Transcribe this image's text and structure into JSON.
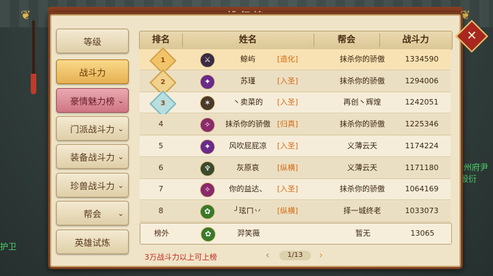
{
  "window": {
    "title": "排行榜"
  },
  "background": {
    "npc_left": "护卫",
    "npc_right_name": "苏州府尹",
    "npc_right_sub": "殷衍"
  },
  "sidebar": {
    "tabs": [
      {
        "label": "等级",
        "state": "normal",
        "chevron": ""
      },
      {
        "label": "战斗力",
        "state": "active",
        "chevron": ""
      },
      {
        "label": "豪情魅力榜",
        "state": "pink",
        "chevron": "⌄"
      },
      {
        "label": "门派战斗力",
        "state": "normal",
        "chevron": "⌄"
      },
      {
        "label": "装备战斗力",
        "state": "normal",
        "chevron": "⌄"
      },
      {
        "label": "珍兽战斗力",
        "state": "normal",
        "chevron": "⌄"
      },
      {
        "label": "帮会",
        "state": "normal",
        "chevron": "⌄"
      },
      {
        "label": "英雄试炼",
        "state": "normal",
        "chevron": ""
      }
    ]
  },
  "table": {
    "headers": {
      "rank": "排名",
      "name": "姓名",
      "guild": "帮会",
      "power": "战斗力"
    },
    "rows": [
      {
        "rank": "1",
        "icon": "sword-class-icon",
        "icon_color": "#3a2a44",
        "name": "鲸屿",
        "title": "[造化]",
        "guild": "抹杀你的骄傲",
        "power": "1334590"
      },
      {
        "rank": "2",
        "icon": "flame-class-icon",
        "icon_color": "#6a2a8a",
        "name": "苏瑾",
        "title": "[入圣]",
        "guild": "抹杀你的骄傲",
        "power": "1294006"
      },
      {
        "rank": "3",
        "icon": "claw-class-icon",
        "icon_color": "#4a3a2a",
        "name": "丶卖菜的",
        "title": "[入圣]",
        "guild": "再创丶辉煌",
        "power": "1242051"
      },
      {
        "rank": "4",
        "icon": "blade-class-icon",
        "icon_color": "#8a2a6a",
        "name": "抹杀你的骄傲",
        "title": "[归真]",
        "guild": "抹杀你的骄傲",
        "power": "1225346"
      },
      {
        "rank": "5",
        "icon": "flame-class-icon",
        "icon_color": "#6a2a8a",
        "name": "风吹屁屁凉",
        "title": "[入圣]",
        "guild": "义薄云天",
        "power": "1174224"
      },
      {
        "rank": "6",
        "icon": "staff-class-icon",
        "icon_color": "#3a4a2a",
        "name": "灰原哀",
        "title": "[纵横]",
        "guild": "义薄云天",
        "power": "1171180"
      },
      {
        "rank": "7",
        "icon": "blade-class-icon",
        "icon_color": "#8a2a6a",
        "name": "你的益达、",
        "title": "[入圣]",
        "guild": "抹杀你的骄傲",
        "power": "1064169"
      },
      {
        "rank": "8",
        "icon": "leaf-class-icon",
        "icon_color": "#3a7a2a",
        "name": "╯玹ㄇ丷",
        "title": "[纵横]",
        "guild": "择一城终老",
        "power": "1033073"
      }
    ],
    "mine": {
      "rank": "榜外",
      "icon": "leaf-class-icon",
      "icon_color": "#3a7a2a",
      "name": "羿笑薇",
      "title": "",
      "guild": "暂无",
      "power": "13065"
    }
  },
  "footer": {
    "note": "3万战斗力以上可上榜",
    "page": "1/13",
    "prev": "‹",
    "next": "›"
  },
  "close_label": "✕"
}
